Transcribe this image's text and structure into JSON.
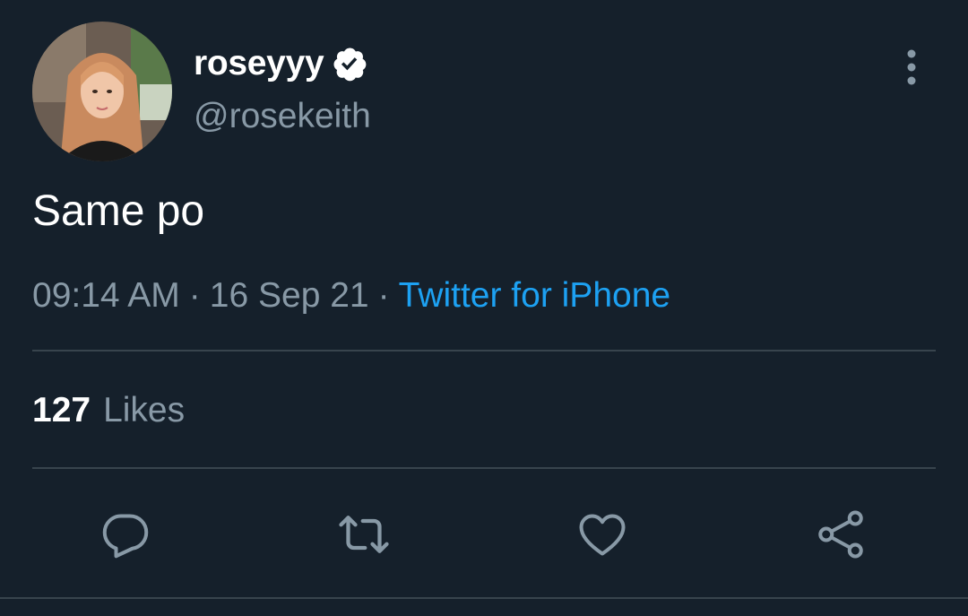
{
  "author": {
    "display_name": "roseyyy",
    "handle": "@rosekeith",
    "verified": true
  },
  "tweet": {
    "text": "Same po",
    "time": "09:14 AM",
    "date": "16 Sep 21",
    "separator": "·",
    "source": "Twitter for iPhone"
  },
  "stats": {
    "likes_count": "127",
    "likes_label": "Likes"
  },
  "icons": {
    "more": "more-vertical-icon",
    "verified": "verified-badge-icon",
    "reply": "reply-icon",
    "retweet": "retweet-icon",
    "like": "heart-icon",
    "share": "share-icon"
  },
  "colors": {
    "background": "#15202b",
    "text": "#ffffff",
    "secondary_text": "#8899a6",
    "link": "#1da1f2",
    "divider": "#38444d"
  }
}
